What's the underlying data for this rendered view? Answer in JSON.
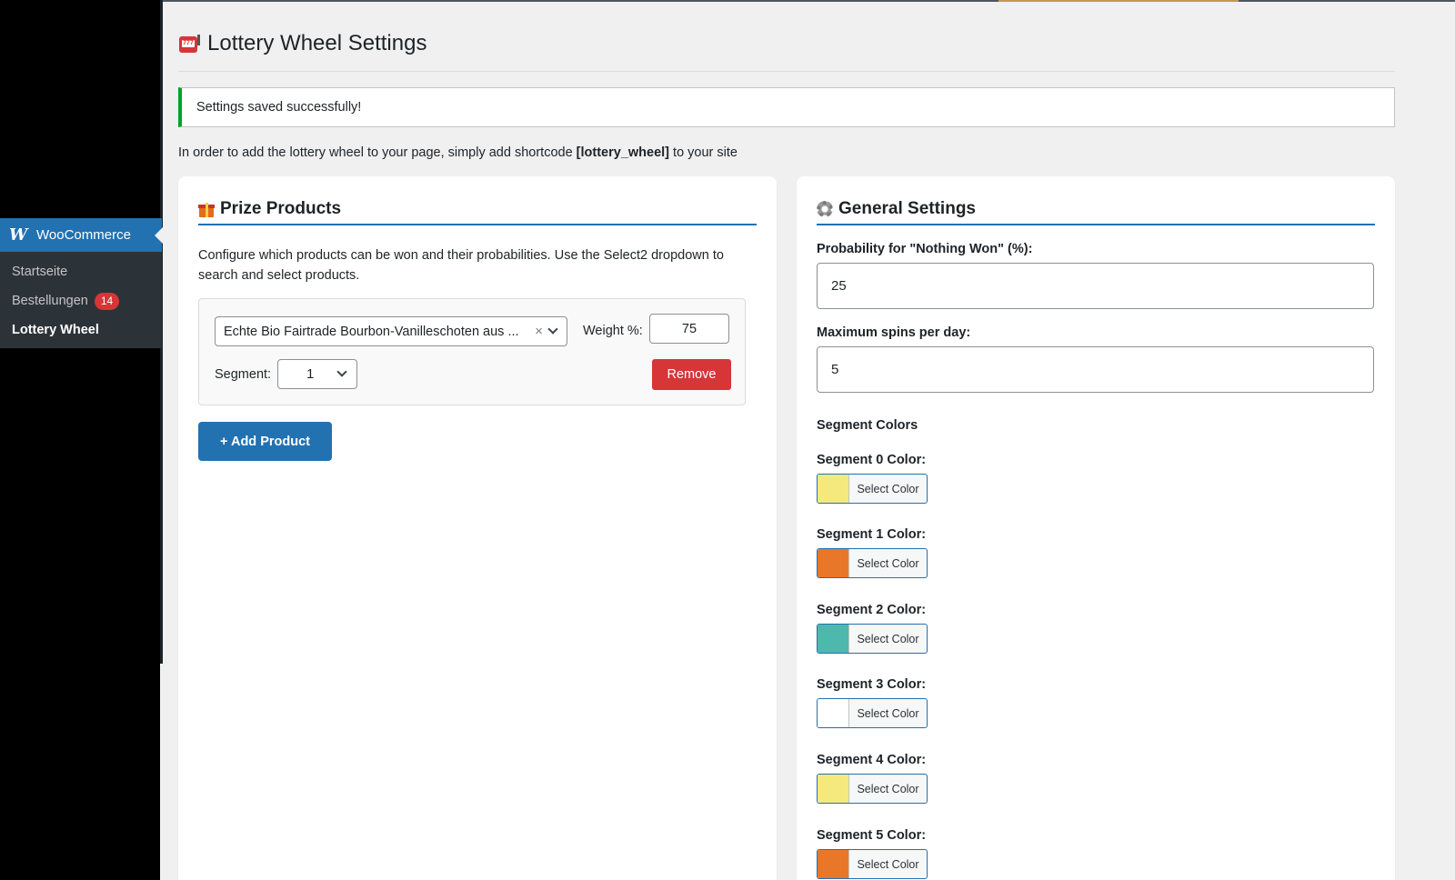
{
  "sidebar": {
    "woo_label": "WooCommerce",
    "items": [
      {
        "label": "Startseite"
      },
      {
        "label": "Bestellungen",
        "badge": "14"
      },
      {
        "label": "Lottery Wheel"
      }
    ]
  },
  "page": {
    "title": "Lottery Wheel Settings",
    "notice": "Settings saved successfully!",
    "intro_before": "In order to add the lottery wheel to your page, simply add shortcode ",
    "intro_code": "[lottery_wheel]",
    "intro_after": " to your site"
  },
  "prize": {
    "title": "Prize Products",
    "description": "Configure which products can be won and their probabilities. Use the Select2 dropdown to search and select products.",
    "product_value": "Echte Bio Fairtrade Bourbon-Vanilleschoten aus ...",
    "clear_glyph": "×",
    "weight_label": "Weight %:",
    "weight_value": "75",
    "segment_label": "Segment:",
    "segment_value": "1",
    "remove_label": "Remove",
    "add_label": "+ Add Product"
  },
  "general": {
    "title": "General Settings",
    "nothing_won_label": "Probability for \"Nothing Won\" (%):",
    "nothing_won_value": "25",
    "max_spins_label": "Maximum spins per day:",
    "max_spins_value": "5",
    "segment_colors_heading": "Segment Colors",
    "select_color_label": "Select Color",
    "segments": [
      {
        "label": "Segment 0 Color:",
        "color": "#f5e97e"
      },
      {
        "label": "Segment 1 Color:",
        "color": "#e8772a"
      },
      {
        "label": "Segment 2 Color:",
        "color": "#4fb8ac"
      },
      {
        "label": "Segment 3 Color:",
        "color": "#ffffff"
      },
      {
        "label": "Segment 4 Color:",
        "color": "#f5e97e"
      },
      {
        "label": "Segment 5 Color:",
        "color": "#e8772a"
      }
    ]
  },
  "colors": {
    "accent": "#2271b1",
    "danger": "#d63638",
    "success": "#00a32a"
  }
}
